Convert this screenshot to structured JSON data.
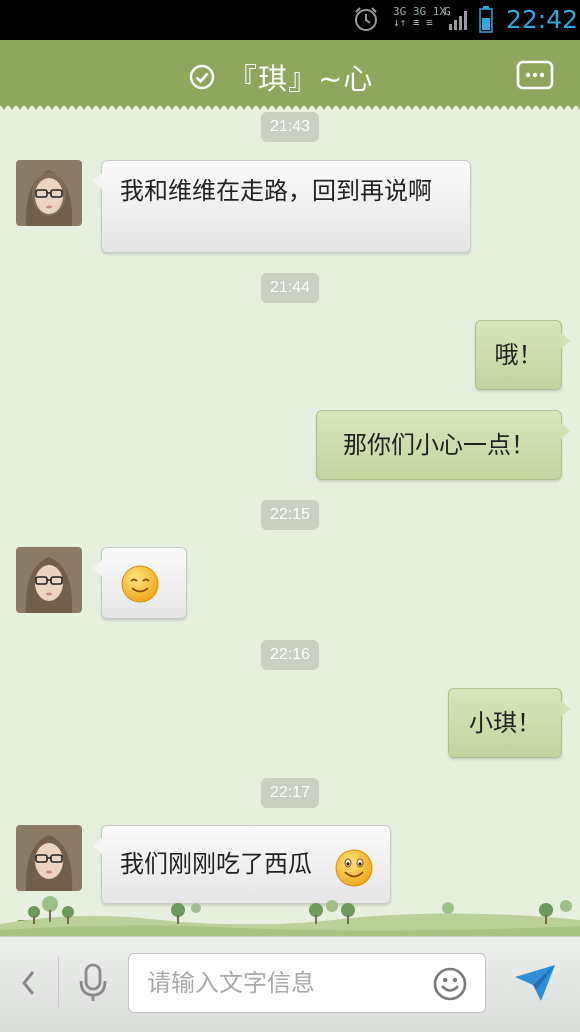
{
  "status_bar": {
    "network_top": "3G 3G 1X",
    "network_bottom": "↓↑ ≡ ≡",
    "network_g": "G",
    "time": "22:42"
  },
  "header": {
    "title": "『琪』~心",
    "status_icon": "check-circle-icon",
    "menu_icon": "more-dots-icon"
  },
  "messages": [
    {
      "type": "time",
      "text": "21:43"
    },
    {
      "type": "in",
      "text": "我和维维在走路，回到再说啊"
    },
    {
      "type": "time",
      "text": "21:44"
    },
    {
      "type": "out",
      "text": "哦！"
    },
    {
      "type": "out",
      "text": "那你们小心一点！"
    },
    {
      "type": "time",
      "text": "22:15"
    },
    {
      "type": "in",
      "emoji": "smile-emoji"
    },
    {
      "type": "time",
      "text": "22:16"
    },
    {
      "type": "out",
      "text": "小琪！"
    },
    {
      "type": "time",
      "text": "22:17"
    },
    {
      "type": "in",
      "text": "我们刚刚吃了西瓜",
      "emoji": "grin-emoji"
    }
  ],
  "input_bar": {
    "placeholder": "请输入文字信息",
    "back_icon": "chevron-left-icon",
    "mic_icon": "microphone-icon",
    "emoji_icon": "smiley-icon",
    "send_icon": "send-arrow-icon"
  },
  "colors": {
    "header_bg": "#8ea75d",
    "chat_bg": "#e7efdf",
    "out_bubble": "#c9d9a9",
    "in_bubble": "#f2f2f2",
    "accent": "#2fa6de"
  }
}
